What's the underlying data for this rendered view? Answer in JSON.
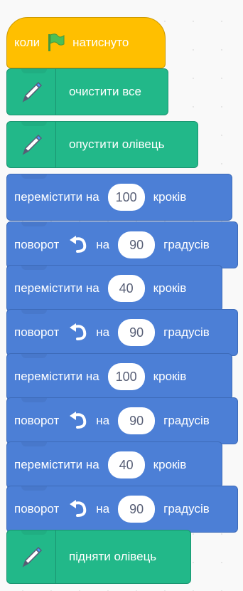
{
  "hat": {
    "when": "коли",
    "clicked": "натиснуто",
    "flag_color": "#4cbf56"
  },
  "blocks": [
    {
      "label": "очистити все"
    },
    {
      "label": "опустити олівець"
    },
    {
      "pre": "перемістити на",
      "value": "100",
      "post": "кроків"
    },
    {
      "pre": "поворот",
      "on": "на",
      "value": "90",
      "post": "градусів"
    },
    {
      "pre": "перемістити на",
      "value": "40",
      "post": "кроків"
    },
    {
      "pre": "поворот",
      "on": "на",
      "value": "90",
      "post": "градусів"
    },
    {
      "pre": "перемістити на",
      "value": "100",
      "post": "кроків"
    },
    {
      "pre": "поворот",
      "on": "на",
      "value": "90",
      "post": "градусів"
    },
    {
      "pre": "перемістити на",
      "value": "40",
      "post": "кроків"
    },
    {
      "pre": "поворот",
      "on": "на",
      "value": "90",
      "post": "градусів"
    },
    {
      "label": "підняти олівець"
    }
  ],
  "colors": {
    "event": "#ffbf00",
    "pen": "#22b889",
    "motion": "#4c7fd6"
  },
  "icons": {
    "flag": "green-flag-icon",
    "pen": "pen-icon",
    "turn": "turn-left-icon"
  }
}
